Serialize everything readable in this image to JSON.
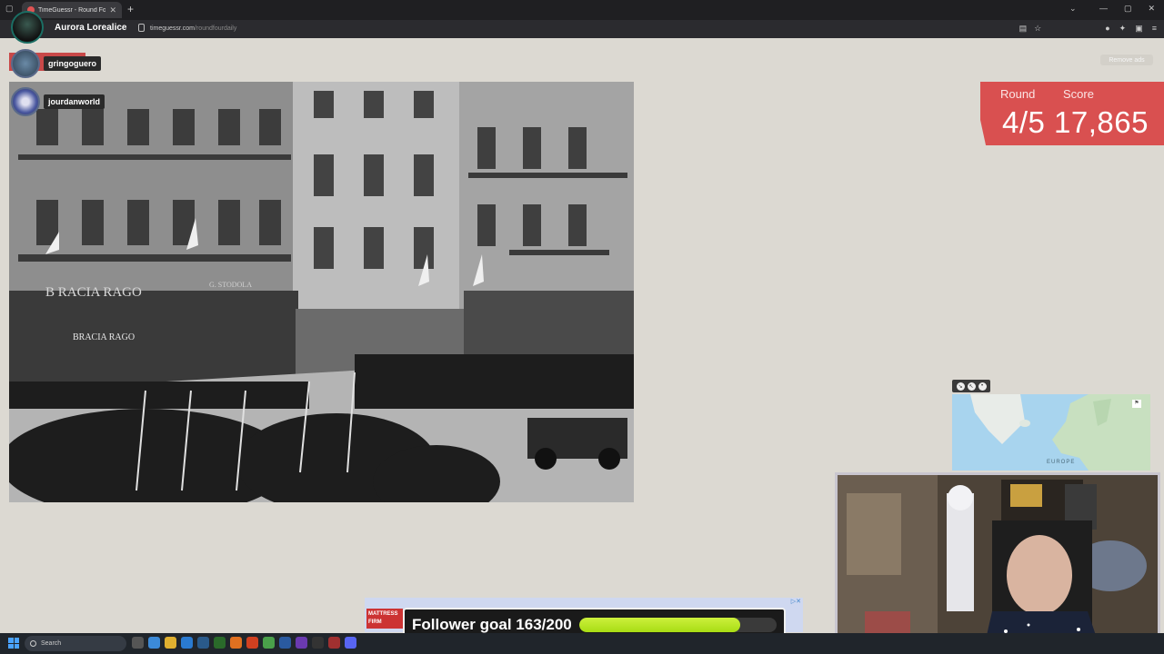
{
  "browser": {
    "tab_title": "TimeGuessr - Round Four",
    "profile_name": "Aurora Lorealice",
    "url_host": "timeguessr.com",
    "url_path": "/roundfourdaily"
  },
  "page": {
    "remove_ads_label": "Remove ads",
    "viewers": [
      {
        "name": "gringoguero"
      },
      {
        "name": "jourdanworld"
      }
    ],
    "score_panel": {
      "round_label": "Round",
      "score_label": "Score",
      "round_value": "4/5",
      "score_value": "17,865"
    },
    "minimap": {
      "region_label": "EUROPE"
    }
  },
  "photo": {
    "shop_sign_1": "B RACIA RAGO",
    "shop_sign_2": "BRACIA RAGO",
    "shop_sign_3": "G. STODOLA"
  },
  "ad": {
    "logo_text": "MATTRESS FIRM"
  },
  "follower_goal": {
    "label": "Follower goal",
    "current": 163,
    "target": 200,
    "display": "Follower goal 163/200",
    "bar_color": "#b8e62a"
  },
  "taskbar": {
    "search_placeholder": "Search"
  },
  "colors": {
    "page_bg": "#dcd9d2",
    "score_red": "#d95050",
    "chrome_dark": "#1f1f22"
  }
}
